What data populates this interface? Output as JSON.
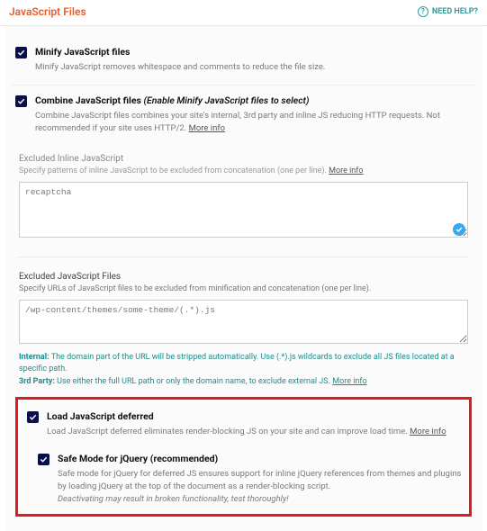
{
  "header": {
    "title": "JavaScript Files",
    "help": "NEED HELP?"
  },
  "opt_minify": {
    "title": "Minify JavaScript files",
    "desc": "Minify JavaScript removes whitespace and comments to reduce the file size."
  },
  "opt_combine": {
    "title": "Combine JavaScript files",
    "note": "(Enable Minify JavaScript files to select)",
    "desc": "Combine JavaScript files combines your site's internal, 3rd party and inline JS reducing HTTP requests. Not recommended if your site uses HTTP/2.",
    "more": "More info"
  },
  "excl_inline": {
    "title": "Excluded Inline JavaScript",
    "desc": "Specify patterns of inline JavaScript to be excluded from concatenation (one per line).",
    "more": "More info",
    "value": "recaptcha",
    "placeholder": ""
  },
  "excl_files": {
    "title": "Excluded JavaScript Files",
    "desc": "Specify URLs of JavaScript files to be excluded from minification and concatenation (one per line).",
    "value": "/wp-content/themes/some-theme/(.*).js"
  },
  "hints": {
    "internal_label": "Internal:",
    "internal_text": "The domain part of the URL will be stripped automatically. Use (.*).js wildcards to exclude all JS files located at a specific path.",
    "third_label": "3rd Party:",
    "third_text": "Use either the full URL path or only the domain name, to exclude external JS.",
    "more": "More info"
  },
  "opt_defer": {
    "title": "Load JavaScript deferred",
    "desc": "Load JavaScript deferred eliminates render-blocking JS on your site and can improve load time.",
    "more": "More info"
  },
  "opt_safe": {
    "title": "Safe Mode for jQuery (recommended)",
    "desc": "Safe mode for jQuery for deferred JS ensures support for inline jQuery references from themes and plugins by loading jQuery at the top of the document as a render-blocking script.",
    "warn": "Deactivating may result in broken functionality, test thoroughly!"
  }
}
